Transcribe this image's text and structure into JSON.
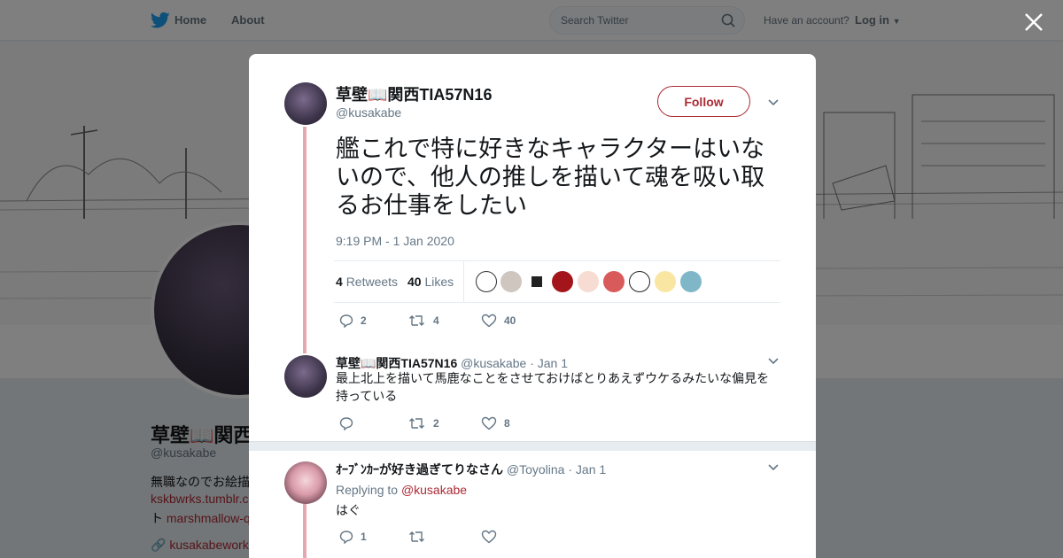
{
  "nav": {
    "home": "Home",
    "about": "About",
    "search_placeholder": "Search Twitter",
    "have_account": "Have an account?",
    "login": "Log in"
  },
  "background_profile": {
    "name": "草壁📖関西",
    "handle": "@kusakabe",
    "bio_line1": "無職なのでお絵描",
    "bio_line2": "kskbwrks.tumblr.c",
    "bio_line3_prefix": "ト",
    "bio_line3_link": "marshmallow-q",
    "link": "kusakabework"
  },
  "main_tweet": {
    "name": "草壁📖関西TIA57N16",
    "handle": "@kusakabe",
    "follow_label": "Follow",
    "text": "艦これで特に好きなキャラクターはいないので、他人の推しを描いて魂を吸い取るお仕事をしたい",
    "time": "9:19 PM - 1 Jan 2020",
    "retweets_count": "4",
    "retweets_label": "Retweets",
    "likes_count": "40",
    "likes_label": "Likes",
    "actions": {
      "reply": "2",
      "retweet": "4",
      "like": "40"
    }
  },
  "replies": [
    {
      "name": "草壁📖関西TIA57N16",
      "handle": "@kusakabe",
      "date": "· Jan 1",
      "text": "最上北上を描いて馬鹿なことをさせておけばとりあえずウケるみたいな偏見を持っている",
      "actions": {
        "reply": "",
        "retweet": "2",
        "like": "8"
      }
    },
    {
      "name": "ｵｰﾌﾞﾝｶｰが好き過ぎてりなさん",
      "handle": "@Toyolina",
      "date": "· Jan 1",
      "replying_prefix": "Replying to",
      "replying_to": "@kusakabe",
      "text": "はぐ",
      "actions": {
        "reply": "1",
        "retweet": "",
        "like": ""
      }
    }
  ],
  "colors": {
    "accent": "#ab2a35",
    "thread_line": "#e5a8b1",
    "muted": "#657786"
  }
}
